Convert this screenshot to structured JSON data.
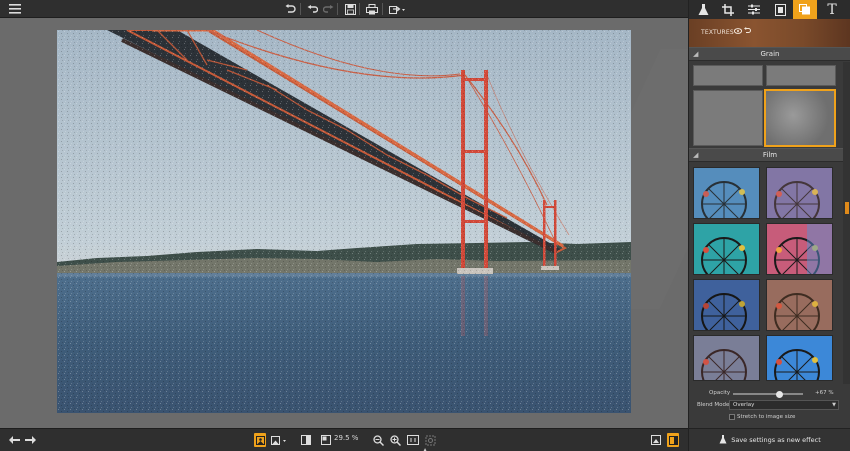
{
  "colors": {
    "accent": "#f0a21b",
    "toolbar_bg": "#2f2f2f",
    "panel_bg": "#3a3a3a",
    "canvas_bg": "#6b6b6b"
  },
  "topbar": {
    "icons": [
      "menu-icon",
      "undo-icon",
      "undo-step-icon",
      "redo-step-icon",
      "save-icon",
      "print-icon",
      "share-icon"
    ]
  },
  "right_panel": {
    "tabs": [
      "flask-icon",
      "crop-icon",
      "adjust-sliders-icon",
      "frame-icon",
      "textures-icon",
      "text-icon"
    ],
    "active_tab": "textures-icon",
    "header": {
      "label": "TEXTURES"
    },
    "sections": {
      "grain": "Grain",
      "film": "Film"
    },
    "opacity": {
      "label": "Opacity",
      "value": "+67 %",
      "level": 0.67
    },
    "blend_mode": {
      "label": "Blend Mode",
      "value": "Overlay"
    },
    "stretch": {
      "label": "Stretch to image size",
      "checked": false
    },
    "save_button": {
      "label": "Save settings as new effect"
    }
  },
  "bottombar": {
    "zoom": "29.5 %",
    "icons": [
      "prev-image-icon",
      "next-image-icon",
      "single-view-icon",
      "image-select-icon",
      "compare-icon",
      "zoom-value-box-icon",
      "zoom-out-icon",
      "zoom-in-icon",
      "fit-to-screen-icon",
      "actual-size-icon",
      "export-icon",
      "panel-toggle-icon"
    ]
  }
}
